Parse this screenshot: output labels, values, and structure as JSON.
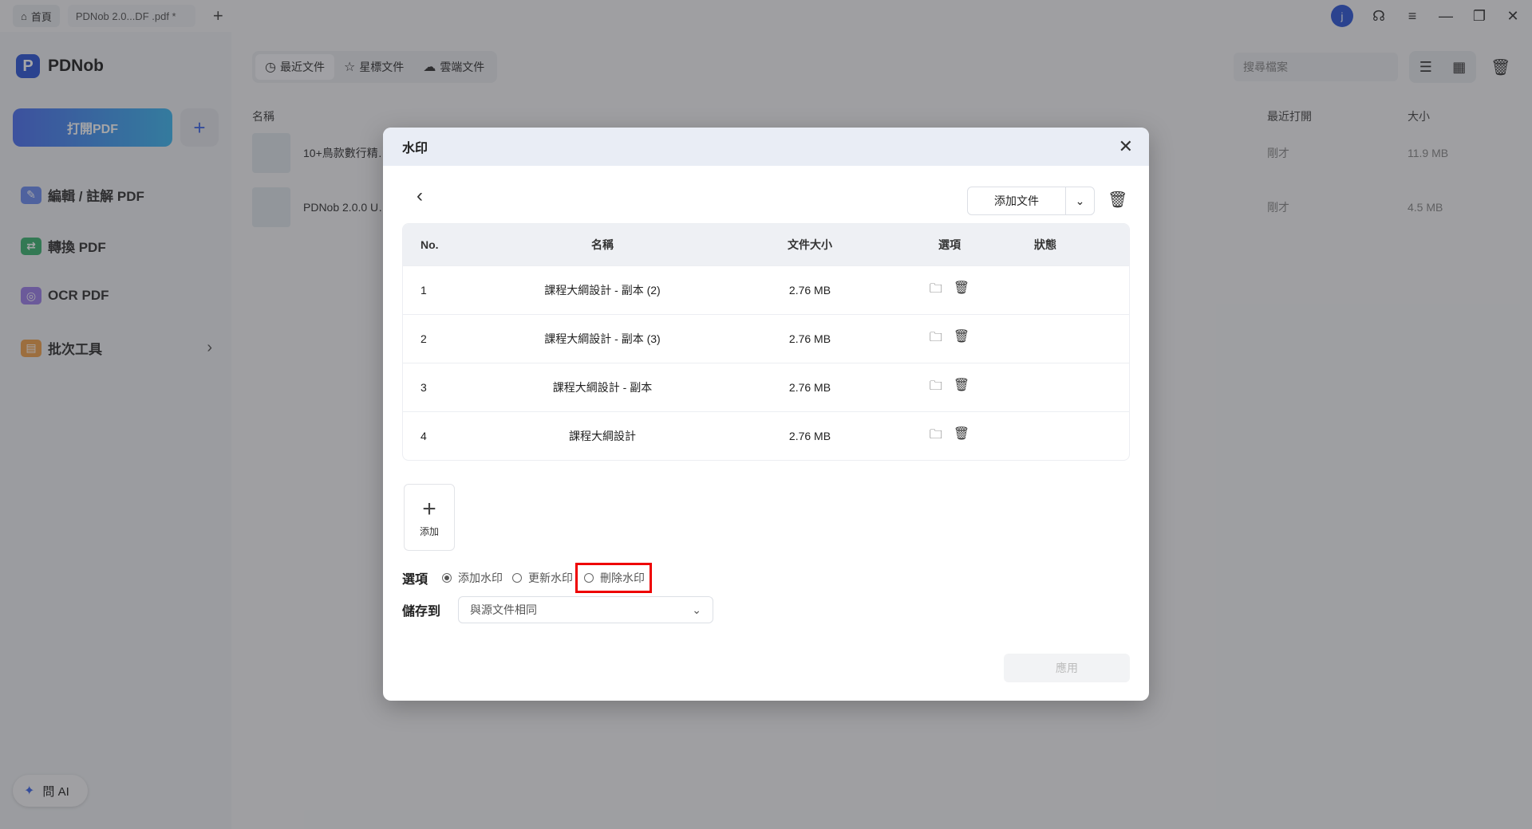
{
  "titlebar": {
    "home_tab": "首頁",
    "doc_tab": "PDNob 2.0...DF .pdf *",
    "new_tab": "+",
    "avatar_initial": "j"
  },
  "sidebar": {
    "logo_text": "PDNob",
    "open_pdf": "打開PDF",
    "add": "+",
    "items": [
      {
        "label": "編輯 / 註解 PDF",
        "icon": "edit-icon"
      },
      {
        "label": "轉換 PDF",
        "icon": "convert-icon"
      },
      {
        "label": "OCR PDF",
        "icon": "ocr-icon"
      },
      {
        "label": "批次工具",
        "icon": "batch-icon"
      }
    ],
    "ask_ai": "問 AI"
  },
  "topnav": {
    "tabs": [
      {
        "label": "最近文件",
        "icon": "clock-icon"
      },
      {
        "label": "星標文件",
        "icon": "star-icon"
      },
      {
        "label": "雲端文件",
        "icon": "cloud-icon"
      }
    ],
    "search_placeholder": "搜尋檔案"
  },
  "file_list": {
    "col_name": "名稱",
    "col_recent": "最近打開",
    "col_size": "大小",
    "rows": [
      {
        "name": "10+鳥款數行精…",
        "recent": "剛才",
        "size": "11.9 MB"
      },
      {
        "name": "PDNob 2.0.0 U…",
        "recent": "剛才",
        "size": "4.5 MB"
      }
    ]
  },
  "modal": {
    "title": "水印",
    "add_file": "添加文件",
    "table": {
      "headers": {
        "no": "No.",
        "name": "名稱",
        "size": "文件大小",
        "options": "選項",
        "status": "狀態"
      },
      "rows": [
        {
          "no": "1",
          "name": "課程大綱設計 - 副本 (2)",
          "size": "2.76 MB",
          "status": ""
        },
        {
          "no": "2",
          "name": "課程大綱設計 - 副本 (3)",
          "size": "2.76 MB",
          "status": ""
        },
        {
          "no": "3",
          "name": "課程大綱設計 - 副本",
          "size": "2.76 MB",
          "status": ""
        },
        {
          "no": "4",
          "name": "課程大綱設計",
          "size": "2.76 MB",
          "status": ""
        }
      ]
    },
    "add_tile": "添加",
    "options_label": "選項",
    "options": [
      {
        "label": "添加水印",
        "checked": true
      },
      {
        "label": "更新水印",
        "checked": false
      },
      {
        "label": "刪除水印",
        "checked": false,
        "highlighted": true
      }
    ],
    "save_label": "儲存到",
    "save_value": "與源文件相同",
    "apply": "應用"
  }
}
